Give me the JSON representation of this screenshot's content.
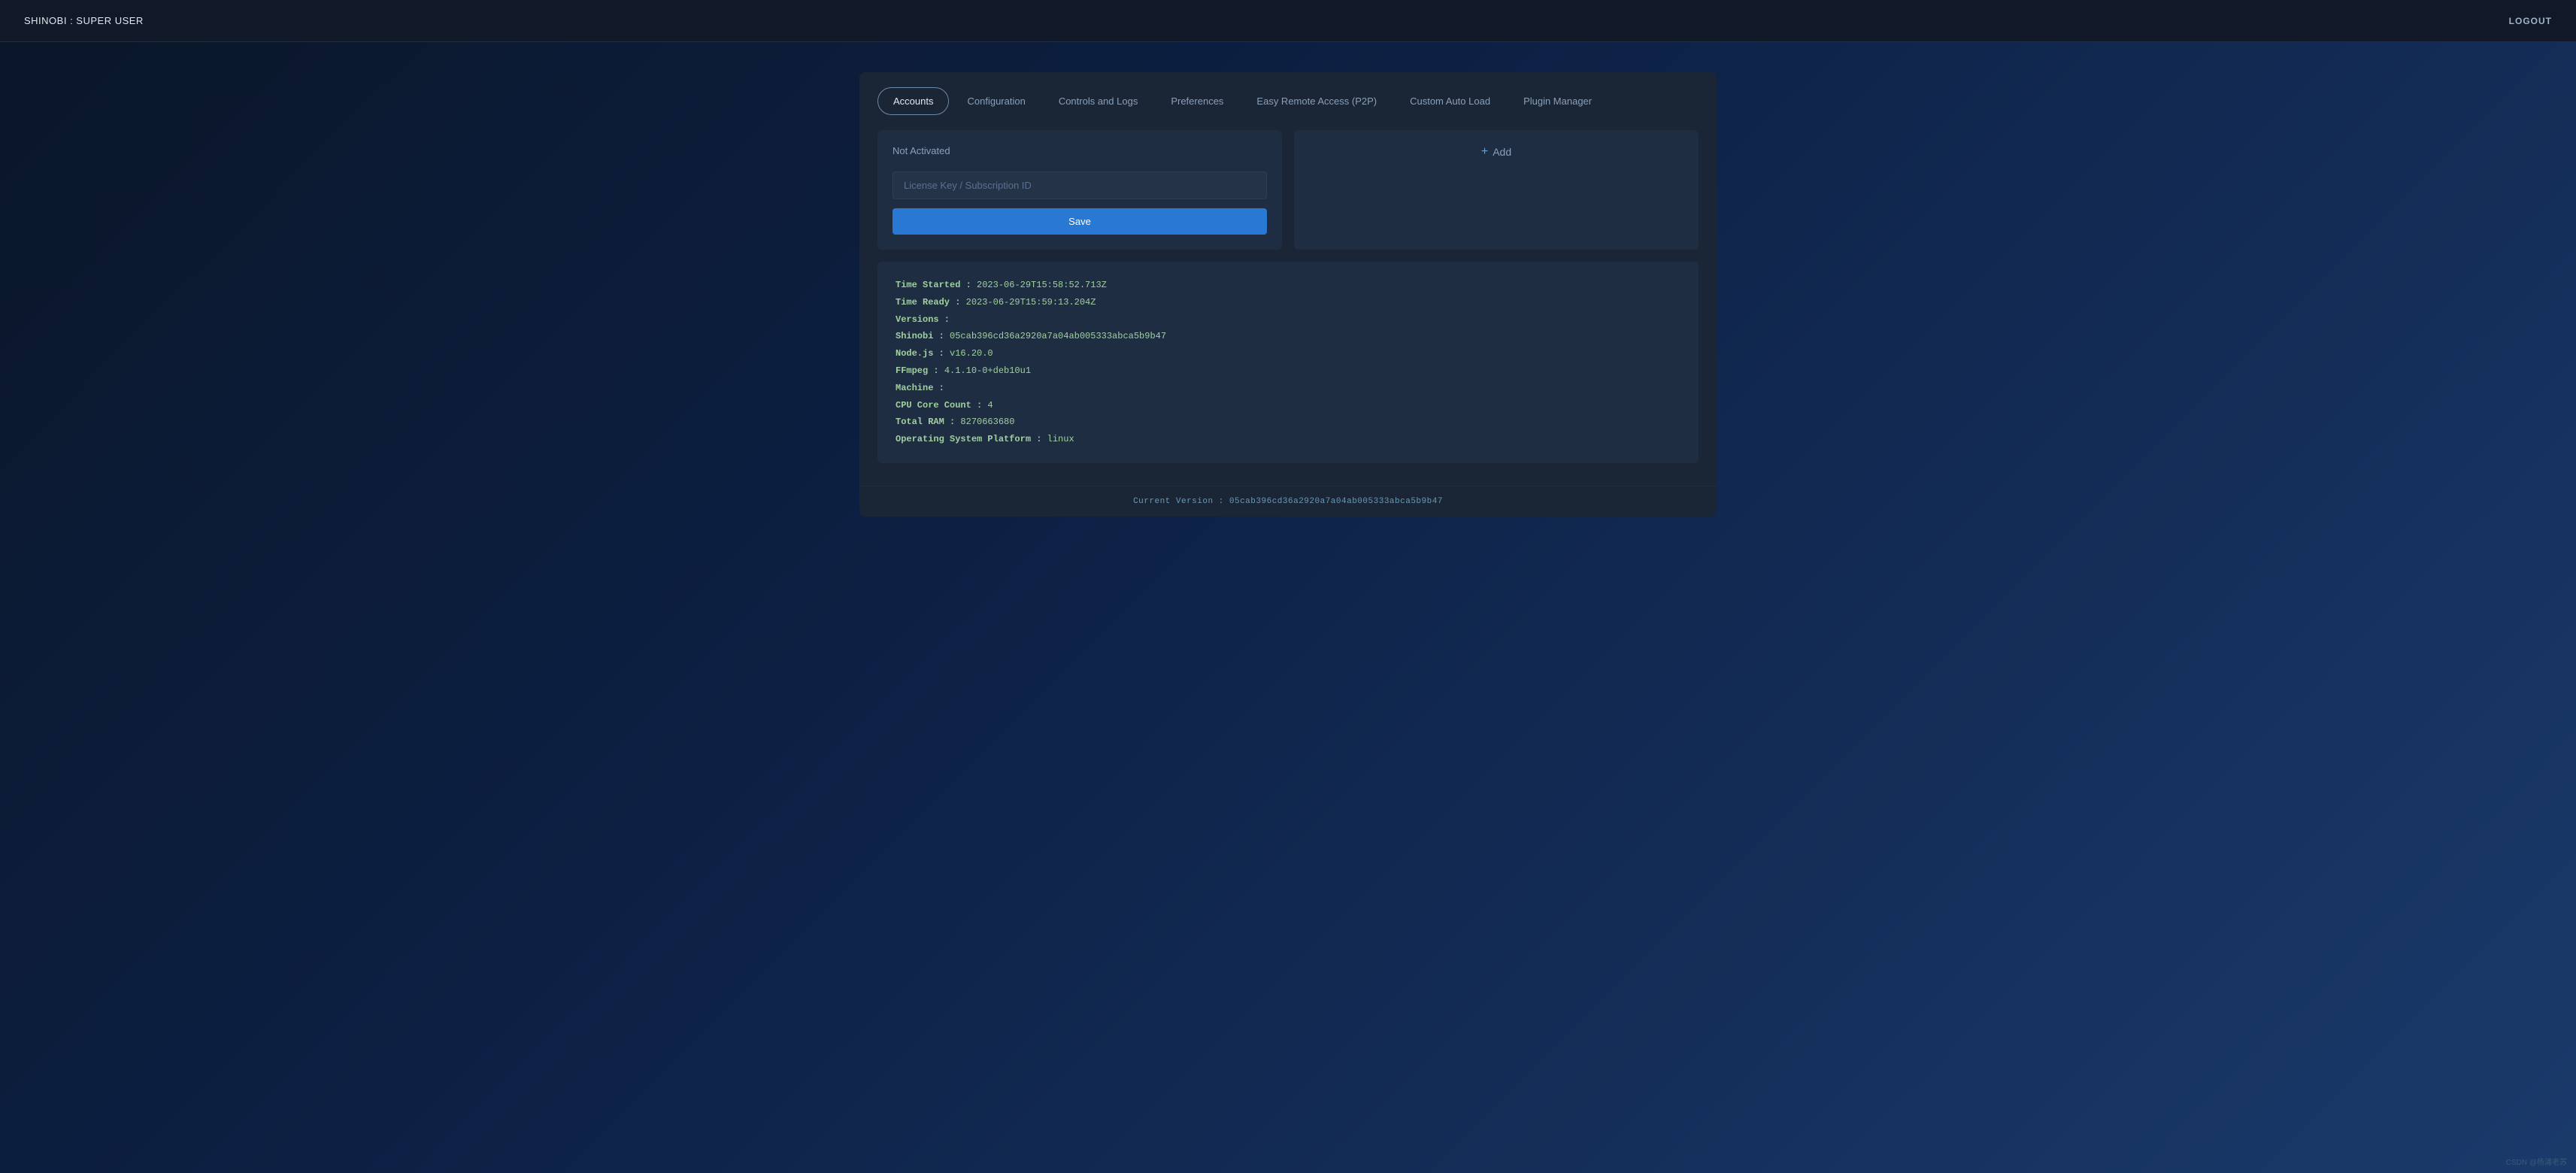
{
  "header": {
    "title": "SHINOBI : SUPER USER",
    "logout_label": "LOGOUT"
  },
  "tabs": [
    {
      "id": "accounts",
      "label": "Accounts",
      "active": true
    },
    {
      "id": "configuration",
      "label": "Configuration",
      "active": false
    },
    {
      "id": "controls-logs",
      "label": "Controls and Logs",
      "active": false
    },
    {
      "id": "preferences",
      "label": "Preferences",
      "active": false
    },
    {
      "id": "easy-remote",
      "label": "Easy Remote Access (P2P)",
      "active": false
    },
    {
      "id": "custom-auto-load",
      "label": "Custom Auto Load",
      "active": false
    },
    {
      "id": "plugin-manager",
      "label": "Plugin Manager",
      "active": false
    }
  ],
  "left_panel": {
    "status": "Not Activated",
    "input_placeholder": "License Key / Subscription ID",
    "save_label": "Save"
  },
  "right_panel": {
    "add_label": "Add"
  },
  "info": {
    "time_started_label": "Time Started : ",
    "time_started_value": "2023-06-29T15:58:52.713Z",
    "time_ready_label": "Time Ready : ",
    "time_ready_value": "2023-06-29T15:59:13.204Z",
    "versions_label": "Versions :",
    "shinobi_label": "  Shinobi : ",
    "shinobi_value": "05cab396cd36a2920a7a04ab005333abca5b9b47",
    "nodejs_label": "  Node.js : ",
    "nodejs_value": "v16.20.0",
    "ffmpeg_label": "  FFmpeg : ",
    "ffmpeg_value": "4.1.10-0+deb10u1",
    "machine_label": "Machine :",
    "cpu_label": "  CPU Core Count : ",
    "cpu_value": "4",
    "ram_label": "  Total RAM : ",
    "ram_value": "8270663680",
    "os_label": "  Operating System Platform : ",
    "os_value": "linux"
  },
  "footer": {
    "text": "Current Version : 05cab396cd36a2920a7a04ab005333abca5b9b47"
  },
  "watermark": {
    "text": "CSDN @杨浦老苏"
  }
}
